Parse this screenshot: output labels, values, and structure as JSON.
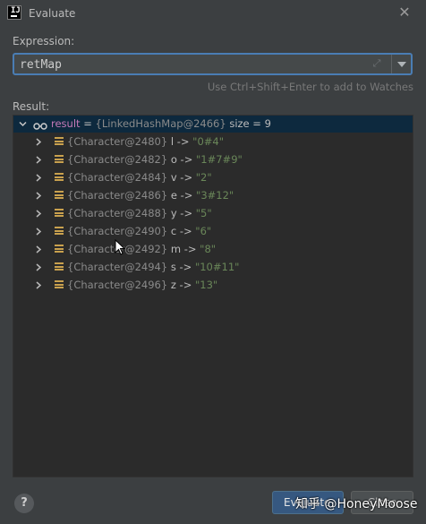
{
  "window": {
    "title": "Evaluate",
    "app_icon_glyph": "IJ"
  },
  "expression": {
    "label": "Expression:",
    "value": "retMap",
    "hint": "Use Ctrl+Shift+Enter to add to Watches"
  },
  "result": {
    "label": "Result:",
    "root": {
      "name": "result",
      "equals": " = ",
      "type_ref": "{LinkedHashMap@2466}",
      "size_text": "  size = 9"
    },
    "entries": [
      {
        "ref": "{Character@2480} ",
        "key": "l",
        "arrow": " -> ",
        "value": "\"0#4\""
      },
      {
        "ref": "{Character@2482} ",
        "key": "o",
        "arrow": " -> ",
        "value": "\"1#7#9\""
      },
      {
        "ref": "{Character@2484} ",
        "key": "v",
        "arrow": " -> ",
        "value": "\"2\""
      },
      {
        "ref": "{Character@2486} ",
        "key": "e",
        "arrow": " -> ",
        "value": "\"3#12\""
      },
      {
        "ref": "{Character@2488} ",
        "key": "y",
        "arrow": " -> ",
        "value": "\"5\""
      },
      {
        "ref": "{Character@2490} ",
        "key": "c",
        "arrow": " -> ",
        "value": "\"6\""
      },
      {
        "ref": "{Character@2492} ",
        "key": "m",
        "arrow": " -> ",
        "value": "\"8\""
      },
      {
        "ref": "{Character@2494} ",
        "key": "s",
        "arrow": " -> ",
        "value": "\"10#11\""
      },
      {
        "ref": "{Character@2496} ",
        "key": "z",
        "arrow": " -> ",
        "value": "\"13\""
      }
    ]
  },
  "buttons": {
    "help": "?",
    "evaluate": "Evaluate",
    "close": "Close"
  },
  "watermark": "知乎 @HoneyMoose",
  "colors": {
    "background": "#3c3f41",
    "panel": "#2b2b2b",
    "accent": "#4a7db4",
    "selected_row": "#0d293e",
    "string_value": "#6a8759",
    "field_icon": "#c9a14e",
    "name": "#c57ab8"
  }
}
